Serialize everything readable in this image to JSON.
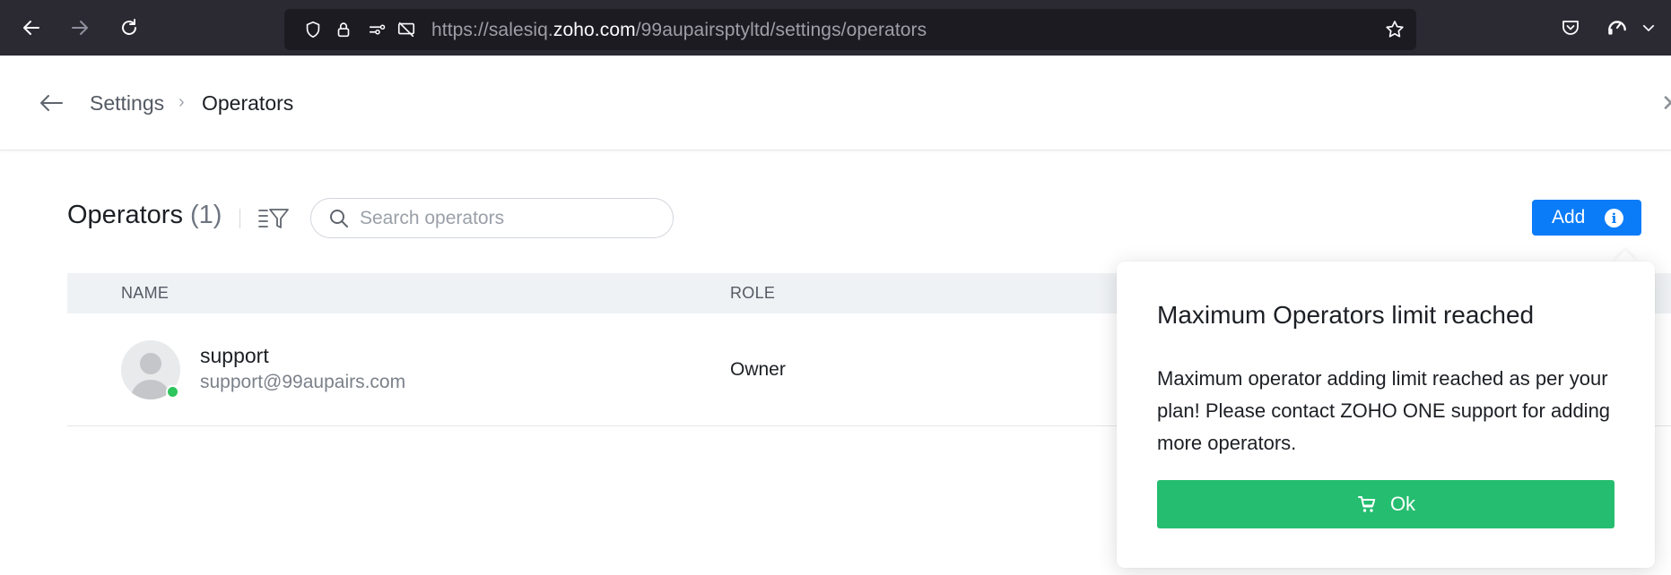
{
  "browser": {
    "url_prefix": "https://salesiq.",
    "url_host": "zoho.com",
    "url_path": "/99aupairsptyltd/settings/operators"
  },
  "breadcrumb": {
    "parent": "Settings",
    "separator": "›",
    "current": "Operators"
  },
  "toolbar": {
    "title": "Operators",
    "count": "(1)",
    "search_placeholder": "Search operators",
    "add_label": "Add",
    "info_glyph": "i"
  },
  "table": {
    "columns": [
      "NAME",
      "ROLE"
    ],
    "rows": [
      {
        "name": "support",
        "email": "support@99aupairs.com",
        "role": "Owner",
        "status": "online"
      }
    ]
  },
  "popover": {
    "title": "Maximum Operators limit reached",
    "body": "Maximum operator adding limit reached as per your plan! Please contact ZOHO ONE support for adding more operators.",
    "button_label": "Ok"
  },
  "colors": {
    "accent": "#0a7cf8",
    "ok_button": "#25bd6f",
    "online": "#2dc55e",
    "browser_chrome": "#2b2a33"
  }
}
